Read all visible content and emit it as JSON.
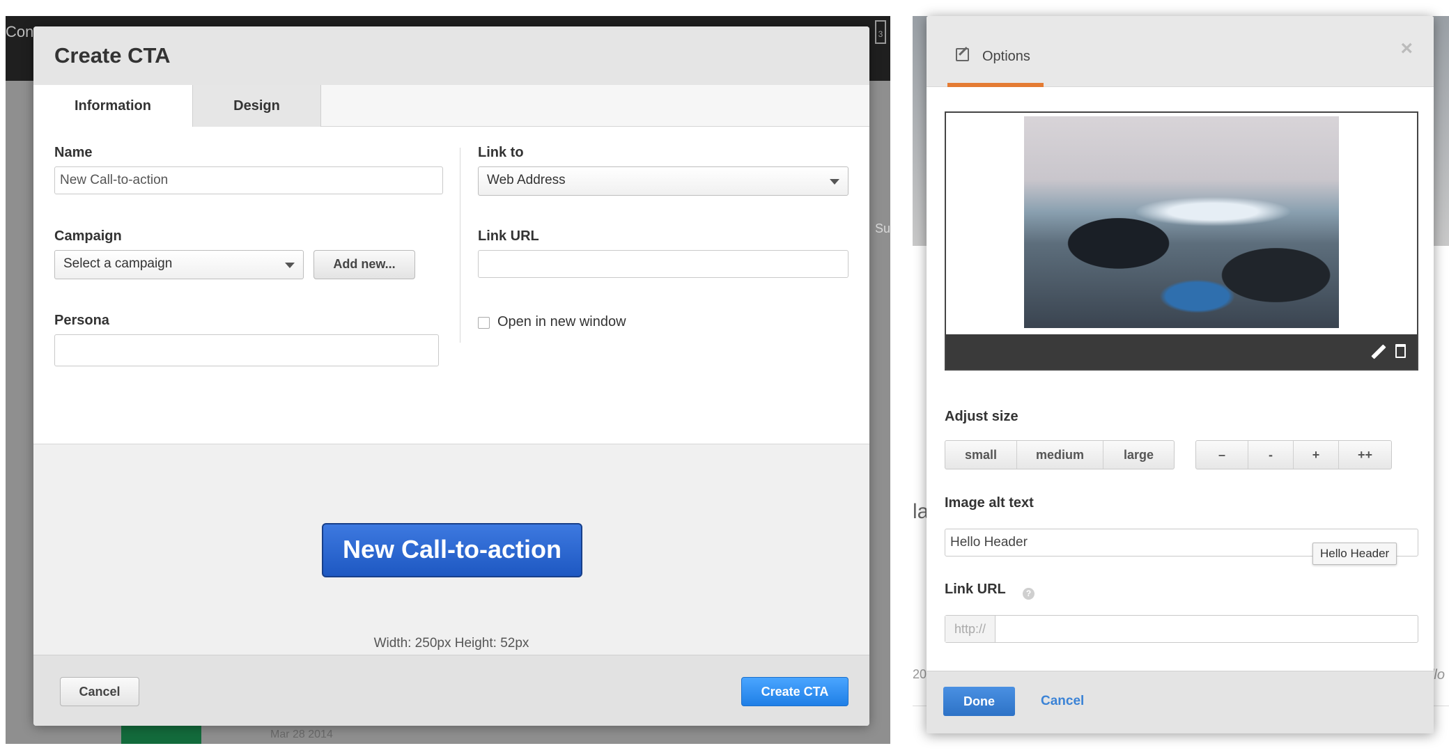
{
  "left": {
    "background": {
      "app_fragment": "Conte",
      "calendar_fragment": "3",
      "side_fragment": "Su",
      "bottom_fragment": "Mar 28 2014"
    },
    "modal": {
      "title": "Create CTA",
      "tabs": [
        {
          "label": "Information",
          "active": true
        },
        {
          "label": "Design",
          "active": false
        }
      ],
      "fields": {
        "name": {
          "label": "Name",
          "value": "New Call-to-action"
        },
        "campaign": {
          "label": "Campaign",
          "selected": "Select a campaign",
          "add_button": "Add new..."
        },
        "persona": {
          "label": "Persona",
          "value": ""
        },
        "link_to": {
          "label": "Link to",
          "selected": "Web Address"
        },
        "link_url": {
          "label": "Link URL",
          "value": ""
        },
        "open_new_window": {
          "label": "Open in new window",
          "checked": false
        }
      },
      "preview": {
        "button_text": "New Call-to-action",
        "dimensions": "Width: 250px   Height: 52px"
      },
      "footer": {
        "cancel": "Cancel",
        "create": "Create CTA"
      }
    }
  },
  "right": {
    "background": {
      "frag_la": "la",
      "frag_20": "20",
      "frag_llo": "llo"
    },
    "options_modal": {
      "tab_label": "Options",
      "close_glyph": "×",
      "adjust_size": {
        "label": "Adjust size",
        "presets": [
          "small",
          "medium",
          "large"
        ],
        "steps": [
          "–",
          "-",
          "+",
          "++"
        ]
      },
      "alt_text": {
        "label": "Image alt text",
        "value": "Hello Header",
        "tooltip": "Hello Header"
      },
      "link_url": {
        "label": "Link URL",
        "help_glyph": "?",
        "prefix": "http://",
        "value": ""
      },
      "footer": {
        "done": "Done",
        "cancel": "Cancel"
      }
    }
  },
  "colors": {
    "cta_blue": "#1e58c2",
    "create_blue": "#1f7fe6",
    "accent_orange": "#e47b33",
    "done_blue": "#2d72c6"
  }
}
